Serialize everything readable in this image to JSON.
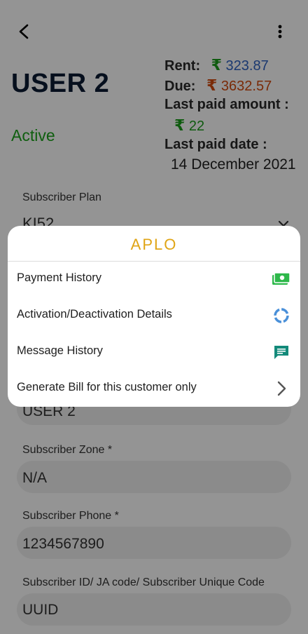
{
  "user": {
    "name": "USER 2",
    "status": "Active"
  },
  "billing": {
    "rent_label": "Rent:",
    "rent_value": "323.87",
    "due_label": "Due:",
    "due_value": "3632.57",
    "last_paid_amount_label": "Last paid amount :",
    "last_paid_amount_value": "22",
    "last_paid_date_label": "Last paid date :",
    "last_paid_date_value": "14 December 2021",
    "currency_symbol": "₹"
  },
  "form": {
    "plan": {
      "label": "Subscriber Plan",
      "value": "KI52"
    },
    "name": {
      "value": "USER 2"
    },
    "zone": {
      "label": "Subscriber Zone *",
      "value": "N/A"
    },
    "phone": {
      "label": "Subscriber Phone *",
      "value": "1234567890"
    },
    "uid": {
      "label": "Subscriber ID/ JA code/ Subscriber Unique Code",
      "value": "UUID"
    }
  },
  "menu": {
    "logo_text": "APLO",
    "items": [
      {
        "label": "Payment History",
        "icon": "cash-icon"
      },
      {
        "label": "Activation/Deactivation Details",
        "icon": "progress-ring-icon"
      },
      {
        "label": "Message History",
        "icon": "message-icon"
      },
      {
        "label": "Generate Bill for this customer only",
        "icon": "chevron-right-icon"
      }
    ]
  },
  "colors": {
    "status_active": "#1aa31a",
    "rent": "#2f62c2",
    "due": "#d24a0e",
    "last_paid": "#1a9d1a",
    "logo": "#e0a516",
    "cash_icon": "#2db84a",
    "ring_icon": "#4a90d9",
    "message_icon": "#138a7a"
  }
}
